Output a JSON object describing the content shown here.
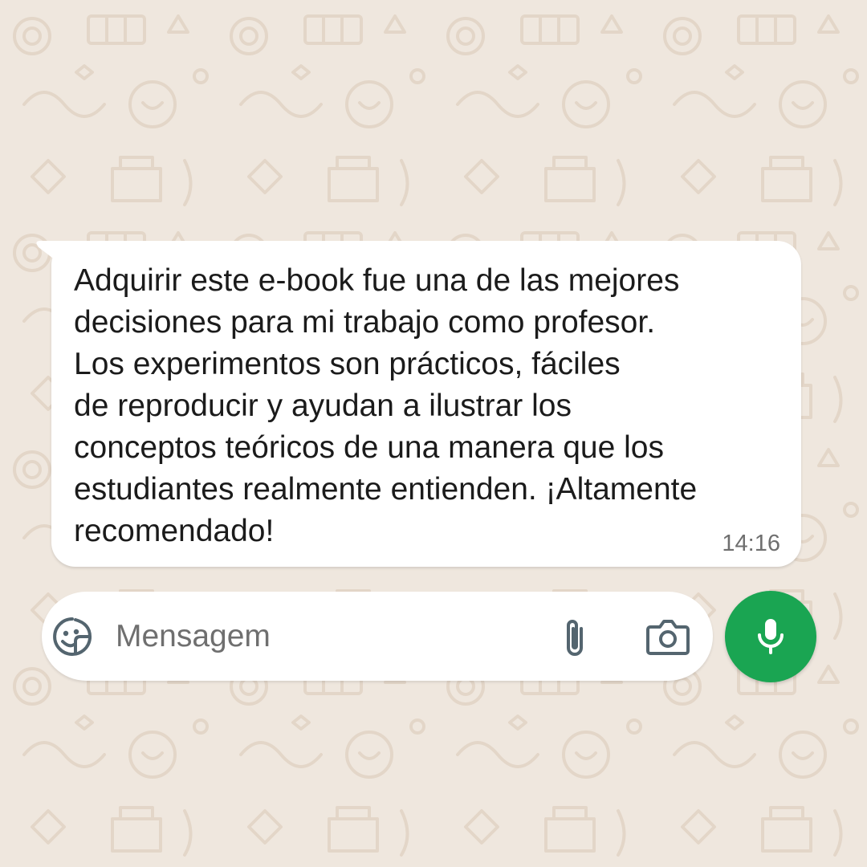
{
  "chat": {
    "message": {
      "text": "Adquirir este e-book fue una de las mejores\ndecisiones para mi trabajo como profesor.\nLos experimentos son prácticos, fáciles\nde reproducir y ayudan a ilustrar los\nconceptos teóricos de una manera que los\nestudiantes realmente entienden. ¡Altamente\nrecomendado!",
      "time": "14:16"
    }
  },
  "composer": {
    "placeholder": "Mensagem",
    "icons": {
      "sticker": "sticker-icon",
      "attach": "paperclip-icon",
      "camera": "camera-icon",
      "mic": "microphone-icon"
    }
  },
  "colors": {
    "background": "#efe7de",
    "bubble": "#ffffff",
    "accent_green": "#1aa552",
    "icon_gray": "#54656f"
  }
}
